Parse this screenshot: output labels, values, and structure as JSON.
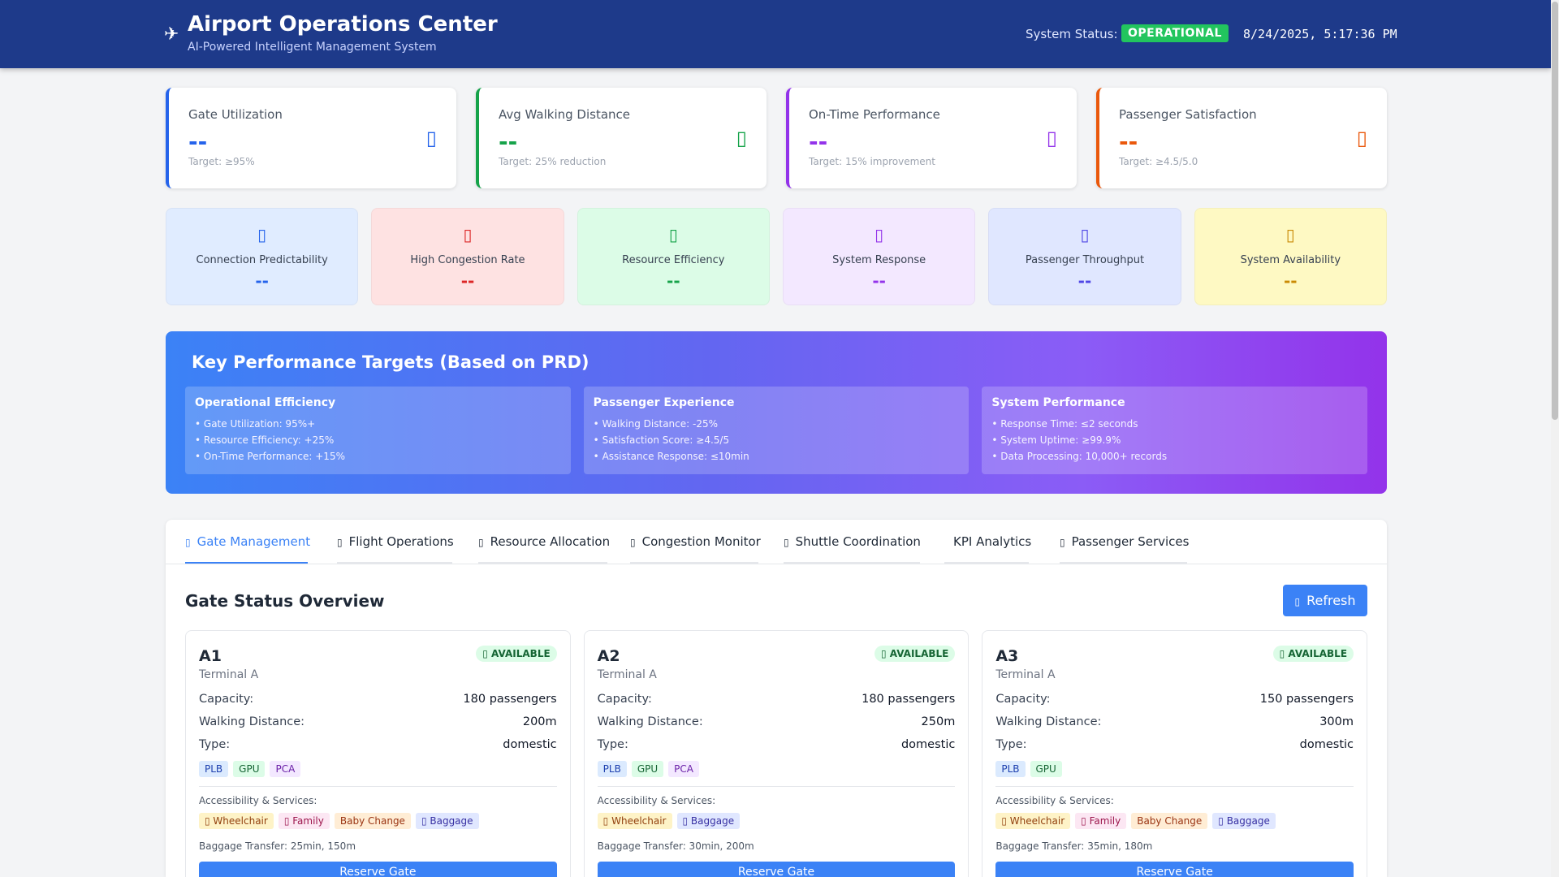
{
  "header": {
    "logo_icon": "plane-icon",
    "title": "Airport Operations Center",
    "subtitle": "AI-Powered Intelligent Management System",
    "status_label": "System Status:",
    "status_value": "OPERATIONAL",
    "datetime": "8/24/2025, 5:17:36 PM"
  },
  "kpis": [
    {
      "label": "Gate Utilization",
      "value": "--",
      "target": "Target: ≥95%",
      "color": "#2563eb",
      "icon": "door-icon"
    },
    {
      "label": "Avg Walking Distance",
      "value": "--",
      "target": "Target: 25% reduction",
      "color": "#16a34a",
      "icon": "walking-icon"
    },
    {
      "label": "On-Time Performance",
      "value": "--",
      "target": "Target: 15% improvement",
      "color": "#9333ea",
      "icon": "clock-icon"
    },
    {
      "label": "Passenger Satisfaction",
      "value": "--",
      "target": "Target: ≥4.5/5.0",
      "color": "#ea580c",
      "icon": "smile-icon"
    }
  ],
  "metrics": [
    {
      "label": "Connection Predictability",
      "value": "--",
      "icon": "link-icon",
      "color": "#2563eb",
      "bg": "#e0ecff"
    },
    {
      "label": "High Congestion Rate",
      "value": "--",
      "icon": "warning-icon",
      "color": "#dc2626",
      "bg": "#fee2e2"
    },
    {
      "label": "Resource Efficiency",
      "value": "--",
      "icon": "cogs-icon",
      "color": "#16a34a",
      "bg": "#dcfce7"
    },
    {
      "label": "System Response",
      "value": "--",
      "icon": "bolt-icon",
      "color": "#9333ea",
      "bg": "#f3e8ff"
    },
    {
      "label": "Passenger Throughput",
      "value": "--",
      "icon": "users-icon",
      "color": "#4f46e5",
      "bg": "#e0e7ff"
    },
    {
      "label": "System Availability",
      "value": "--",
      "icon": "server-icon",
      "color": "#ca8a04",
      "bg": "#fef9c3"
    }
  ],
  "targets": {
    "title": "Key Performance Targets (Based on PRD)",
    "groups": [
      {
        "title": "Operational Efficiency",
        "items": [
          "• Gate Utilization: 95%+",
          "• Resource Efficiency: +25%",
          "• On-Time Performance: +15%"
        ]
      },
      {
        "title": "Passenger Experience",
        "items": [
          "• Walking Distance: -25%",
          "• Satisfaction Score: ≥4.5/5",
          "• Assistance Response: ≤10min"
        ]
      },
      {
        "title": "System Performance",
        "items": [
          "• Response Time: ≤2 seconds",
          "• System Uptime: ≥99.9%",
          "• Data Processing: 10,000+ records"
        ]
      }
    ]
  },
  "tabs": [
    {
      "label": "Gate Management",
      "icon": "door-icon",
      "active": true
    },
    {
      "label": "Flight Operations",
      "icon": "plane-icon",
      "active": false
    },
    {
      "label": "Resource Allocation",
      "icon": "truck-icon",
      "active": false
    },
    {
      "label": "Congestion Monitor",
      "icon": "users-icon",
      "active": false
    },
    {
      "label": "Shuttle Coordination",
      "icon": "bus-icon",
      "active": false
    },
    {
      "label": "KPI Analytics",
      "icon": "",
      "active": false
    },
    {
      "label": "Passenger Services",
      "icon": "user-icon",
      "active": false
    }
  ],
  "section": {
    "title": "Gate Status Overview",
    "refresh_label": "Refresh"
  },
  "gates": [
    {
      "name": "A1",
      "terminal": "Terminal A",
      "status": "AVAILABLE",
      "capacity_label": "Capacity:",
      "capacity": "180 passengers",
      "distance_label": "Walking Distance:",
      "distance": "200m",
      "type_label": "Type:",
      "type": "domestic",
      "equipment": [
        "PLB",
        "GPU",
        "PCA"
      ],
      "accessibility_label": "Accessibility & Services:",
      "services": [
        "Wheelchair",
        "Family",
        "Baby Change",
        "Baggage"
      ],
      "baggage": "Baggage Transfer: 25min, 150m",
      "reserve_label": "Reserve Gate"
    },
    {
      "name": "A2",
      "terminal": "Terminal A",
      "status": "AVAILABLE",
      "capacity_label": "Capacity:",
      "capacity": "180 passengers",
      "distance_label": "Walking Distance:",
      "distance": "250m",
      "type_label": "Type:",
      "type": "domestic",
      "equipment": [
        "PLB",
        "GPU",
        "PCA"
      ],
      "accessibility_label": "Accessibility & Services:",
      "services": [
        "Wheelchair",
        "Baggage"
      ],
      "baggage": "Baggage Transfer: 30min, 200m",
      "reserve_label": "Reserve Gate"
    },
    {
      "name": "A3",
      "terminal": "Terminal A",
      "status": "AVAILABLE",
      "capacity_label": "Capacity:",
      "capacity": "150 passengers",
      "distance_label": "Walking Distance:",
      "distance": "300m",
      "type_label": "Type:",
      "type": "domestic",
      "equipment": [
        "PLB",
        "GPU"
      ],
      "accessibility_label": "Accessibility & Services:",
      "services": [
        "Wheelchair",
        "Family",
        "Baby Change",
        "Baggage"
      ],
      "baggage": "Baggage Transfer: 35min, 180m",
      "reserve_label": "Reserve Gate"
    }
  ]
}
